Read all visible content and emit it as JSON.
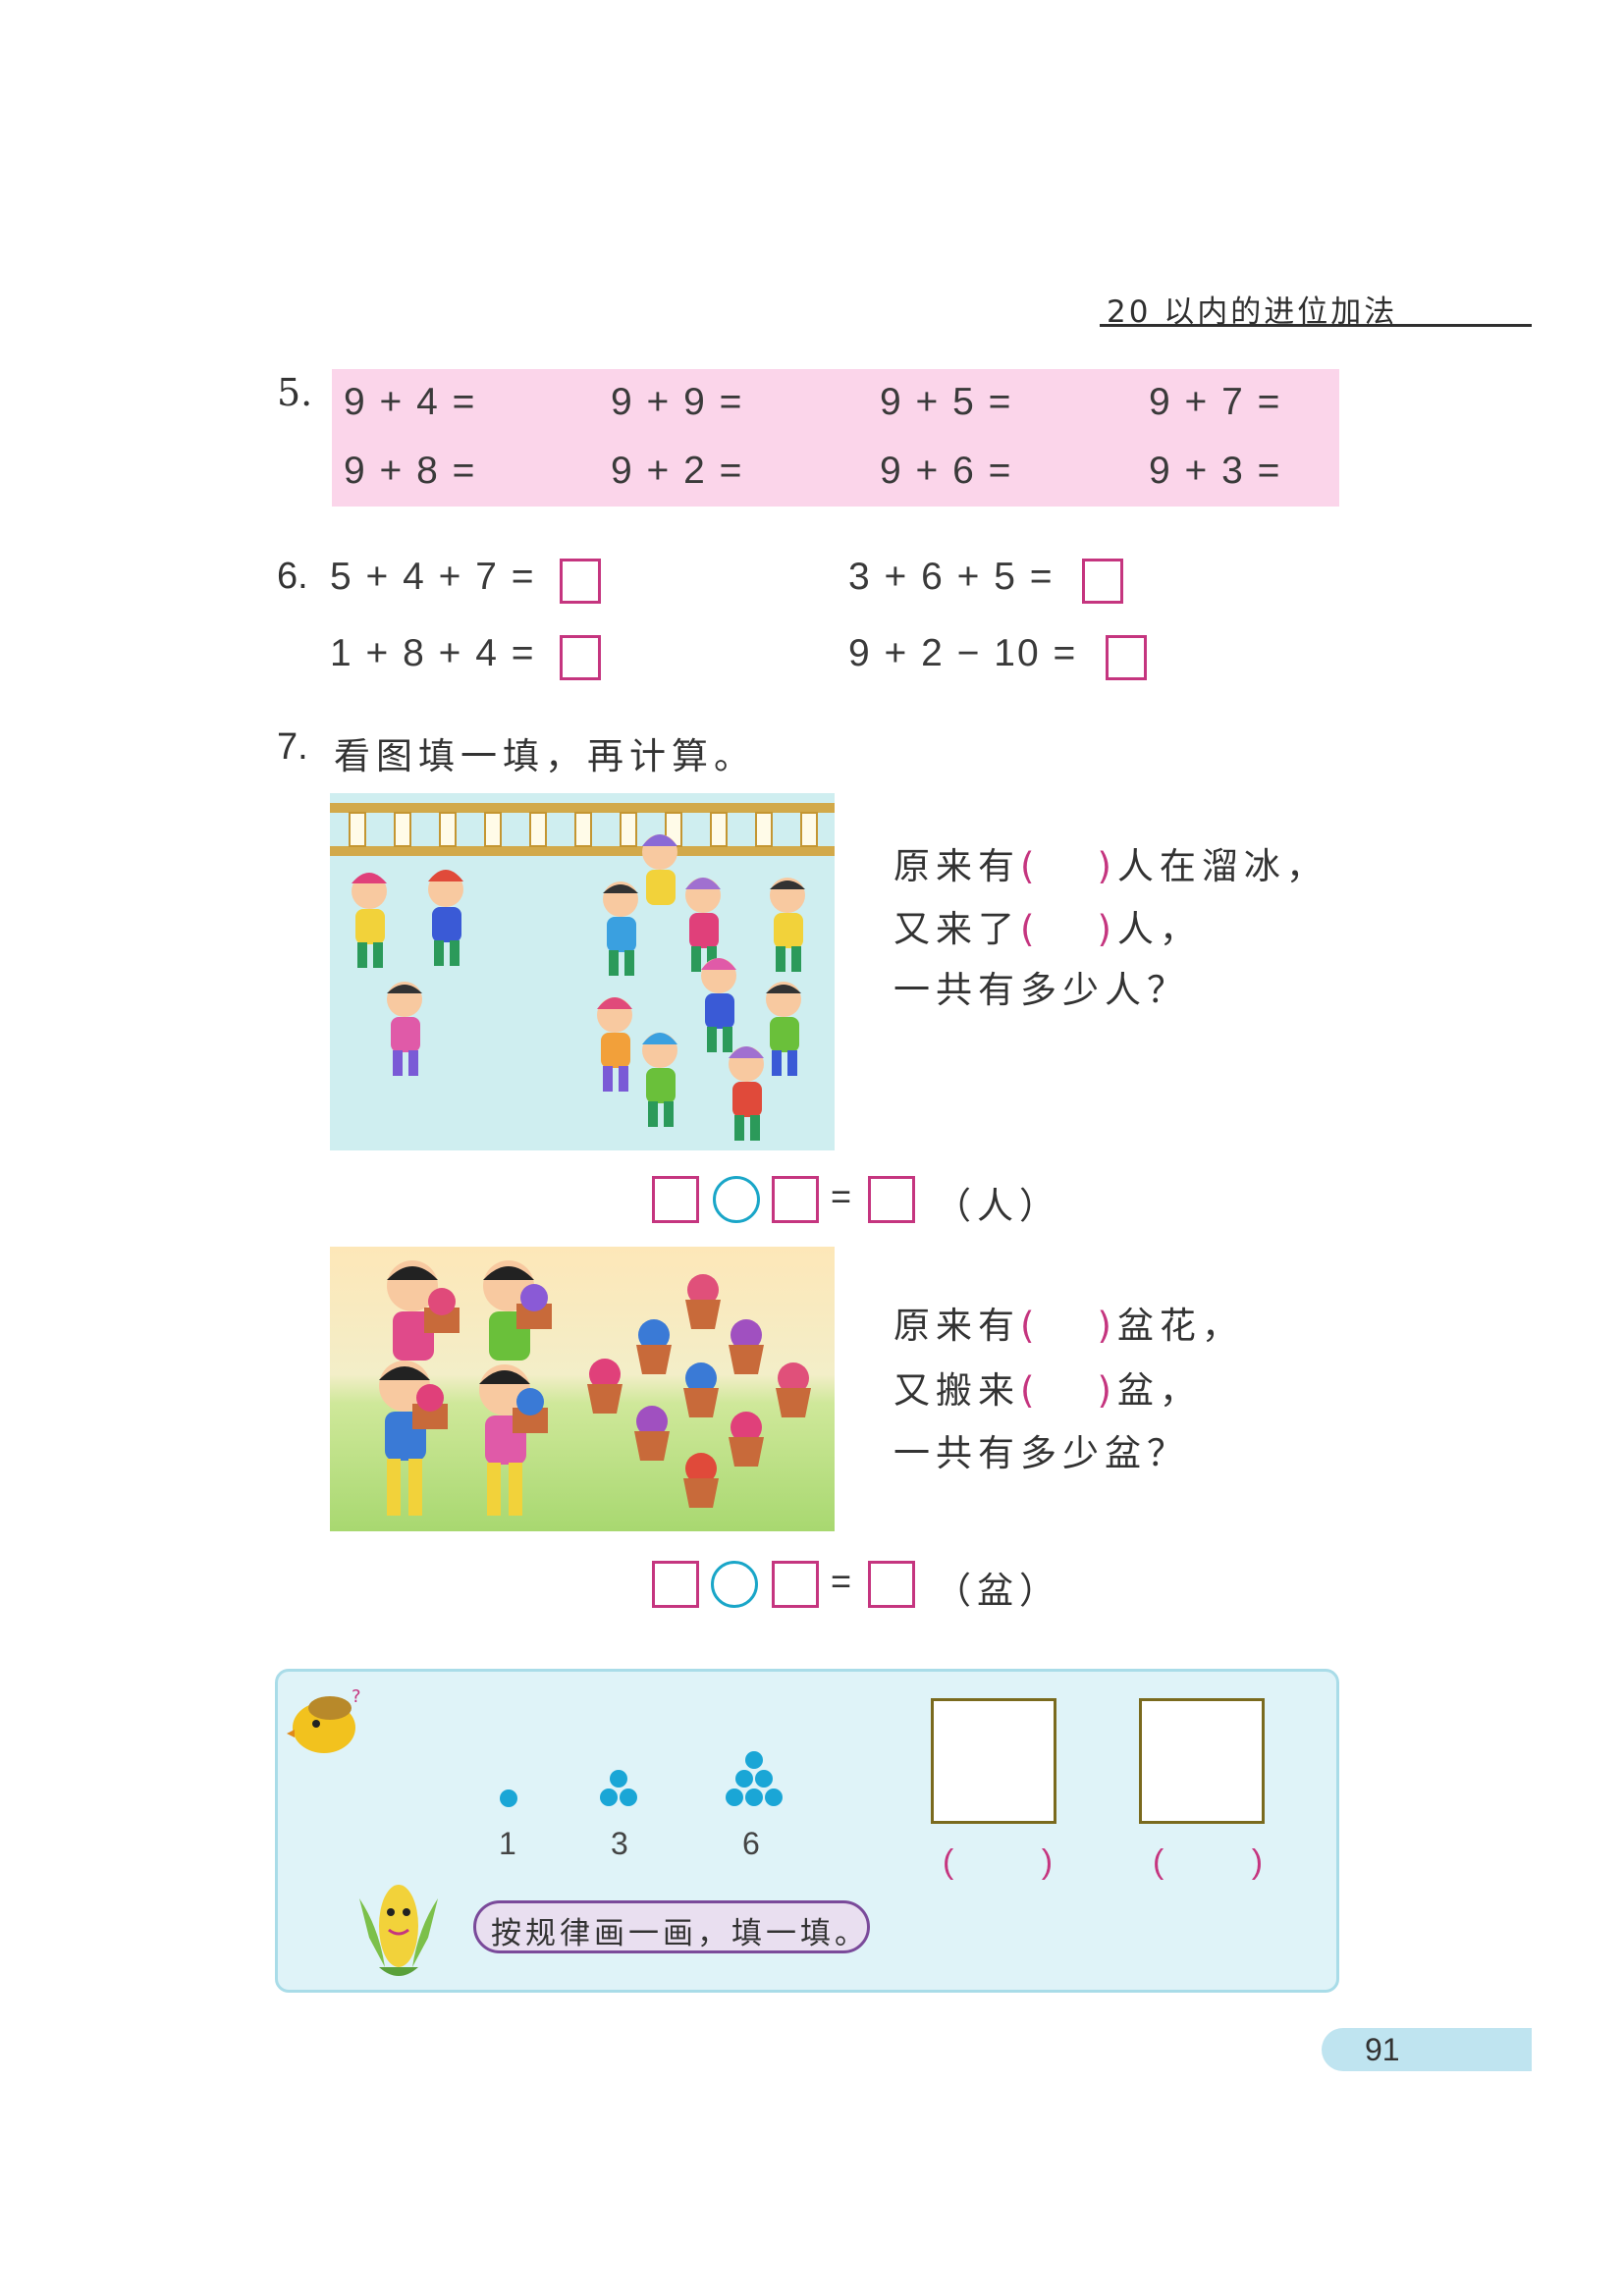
{
  "header": {
    "title": "20 以内的进位加法"
  },
  "problem5": {
    "number": "5.",
    "rows": [
      [
        "9 + 4 =",
        "9 + 9 =",
        "9 + 5 =",
        "9 + 7 ="
      ],
      [
        "9 + 8 =",
        "9 + 2 =",
        "9 + 6 =",
        "9 + 3 ="
      ]
    ]
  },
  "problem6": {
    "number": "6.",
    "equations": [
      "5 + 4 + 7 =",
      "3 + 6 + 5 =",
      "1 + 8 + 4 =",
      "9 + 2 − 10 ="
    ]
  },
  "problem7": {
    "number": "7.",
    "instruction": "看图填一填，再计算。",
    "scene1": {
      "line1_a": "原来有",
      "line1_b": "人在溜冰，",
      "line2_a": "又来了",
      "line2_b": "人，",
      "line3": "一共有多少人？",
      "paren_open": "(",
      "paren_close": ")",
      "unit": "（人）",
      "equals": "="
    },
    "scene2": {
      "line1_a": "原来有",
      "line1_b": "盆花，",
      "line2_a": "又搬来",
      "line2_b": "盆，",
      "line3": "一共有多少盆？",
      "paren_open": "(",
      "paren_close": ")",
      "unit": "（盆）",
      "equals": "="
    }
  },
  "pattern": {
    "labels": [
      "1",
      "3",
      "6"
    ],
    "answer_parens": [
      "(  )",
      "(  )"
    ],
    "bubble_text": "按规律画一画，填一填。",
    "dot_color": "#1aa6d6"
  },
  "page_number": "91",
  "colors": {
    "accent_magenta": "#c5357f",
    "accent_cyan": "#1aa6c8",
    "pink_box": "#fbd5ea",
    "panel_blue": "#dff3f8"
  }
}
